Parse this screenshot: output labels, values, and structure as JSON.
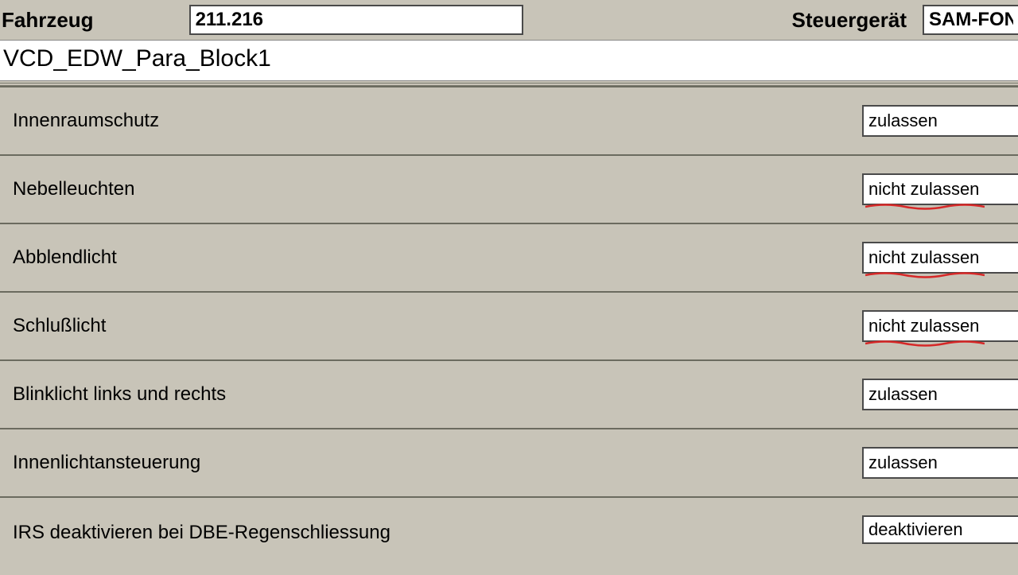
{
  "header": {
    "vehicle_label": "Fahrzeug",
    "vehicle_value": "211.216",
    "ecu_label": "Steuergerät",
    "ecu_value": "SAM-FON"
  },
  "block_title": "VCD_EDW_Para_Block1",
  "params": [
    {
      "label": "Innenraumschutz",
      "value": "zulassen",
      "marked": false
    },
    {
      "label": "Nebelleuchten",
      "value": "nicht zulassen",
      "marked": true
    },
    {
      "label": "Abblendlicht",
      "value": "nicht zulassen",
      "marked": true
    },
    {
      "label": "Schlußlicht",
      "value": "nicht zulassen",
      "marked": true
    },
    {
      "label": "Blinklicht links und rechts",
      "value": "zulassen",
      "marked": false
    },
    {
      "label": "Innenlichtansteuerung",
      "value": "zulassen",
      "marked": false
    },
    {
      "label": "IRS deaktivieren bei DBE-Regenschliessung",
      "value": "deaktivieren",
      "marked": false
    }
  ]
}
